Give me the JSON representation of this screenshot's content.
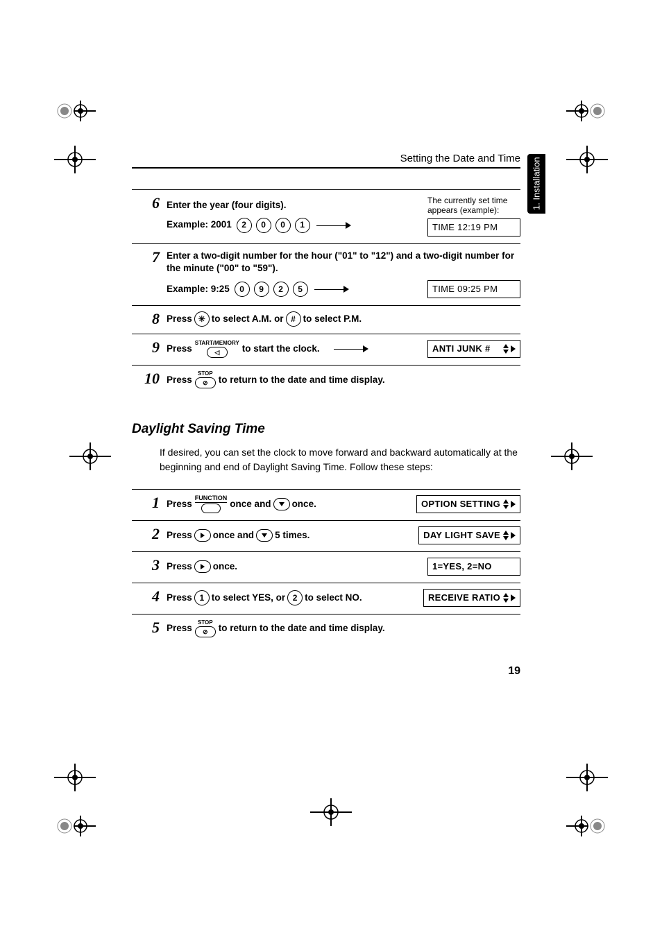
{
  "header": {
    "title": "Setting the Date and Time",
    "side_tab": "1. Installation"
  },
  "steps_a": [
    {
      "num": "6",
      "line1": "Enter the year (four digits).",
      "example_label": "Example: 2001",
      "keys": [
        "2",
        "0",
        "0",
        "1"
      ],
      "display_note_l1": "The currently set time",
      "display_note_l2": "appears (example):",
      "display": "TIME 12:19 PM"
    },
    {
      "num": "7",
      "line1": "Enter a two-digit number for the hour (\"01\" to \"12\") and a two-digit number for the minute (\"00\" to \"59\").",
      "example_label": "Example: 9:25",
      "keys": [
        "0",
        "9",
        "2",
        "5"
      ],
      "display": "TIME 09:25 PM"
    },
    {
      "num": "8",
      "pre": "Press",
      "key1": "✳",
      "mid": "to select A.M. or",
      "key2": "#",
      "post": "to select P.M."
    },
    {
      "num": "9",
      "pre": "Press",
      "btn_label": "START/MEMORY",
      "post": "to start the clock.",
      "display": "ANTI JUNK #"
    },
    {
      "num": "10",
      "pre": "Press",
      "btn_label": "STOP",
      "post": "to return to the date and time display."
    }
  ],
  "dst": {
    "title": "Daylight Saving Time",
    "intro": "If desired, you can set the clock to move forward and backward automatically at the beginning and end of Daylight Saving Time. Follow these steps:"
  },
  "steps_b": [
    {
      "num": "1",
      "pre": "Press",
      "func_label": "FUNCTION",
      "mid": "once and",
      "arrow": "down",
      "post": "once.",
      "display": "OPTION SETTING"
    },
    {
      "num": "2",
      "pre": "Press",
      "arrow1": "right",
      "mid": "once and",
      "arrow2": "down",
      "post": "5 times.",
      "display": "DAY LIGHT SAVE"
    },
    {
      "num": "3",
      "pre": "Press",
      "arrow": "right",
      "post": "once.",
      "display": "1=YES, 2=NO"
    },
    {
      "num": "4",
      "pre": "Press",
      "key1": "1",
      "mid": "to select YES, or",
      "key2": "2",
      "post": "to select NO.",
      "display": "RECEIVE RATIO"
    },
    {
      "num": "5",
      "pre": "Press",
      "btn_label": "STOP",
      "post": "to return to the date and time display."
    }
  ],
  "page_number": "19"
}
